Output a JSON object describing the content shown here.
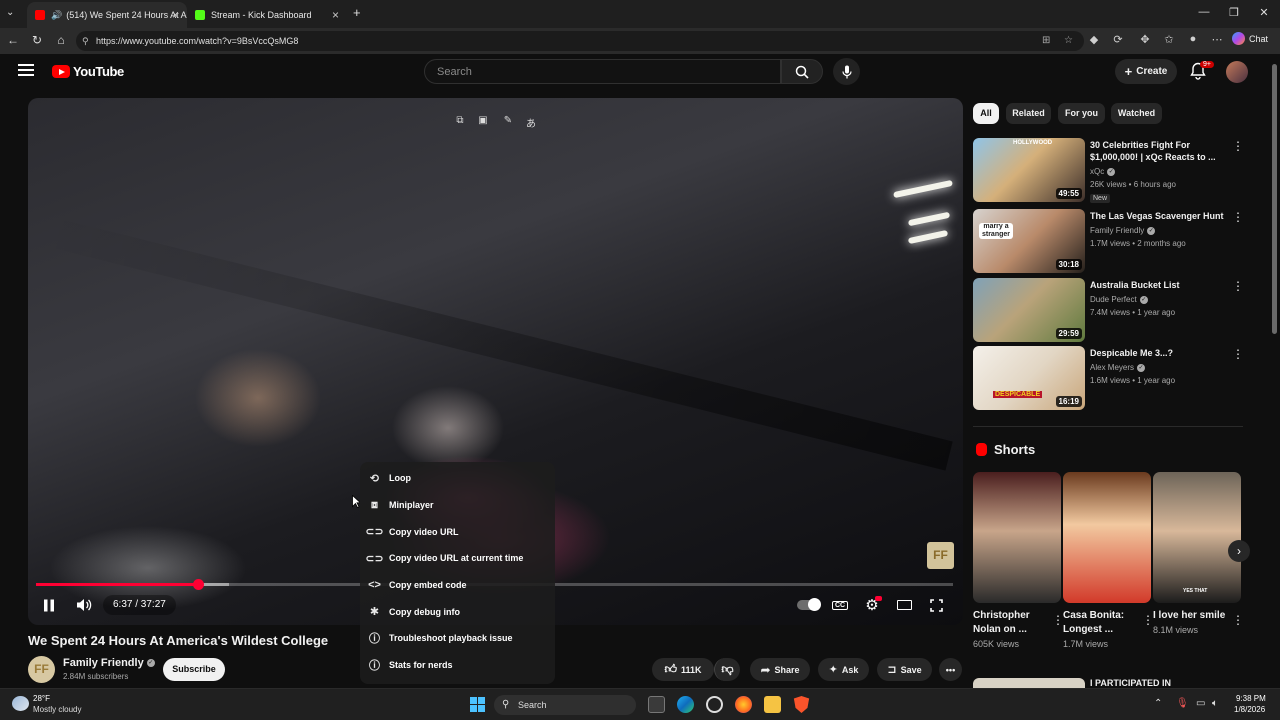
{
  "browser": {
    "tabs": [
      {
        "title": "(514) We Spent 24 Hours At A",
        "active": true
      },
      {
        "title": "Stream - Kick Dashboard",
        "active": false
      }
    ],
    "new_tab": "+",
    "url": "https://www.youtube.com/watch?v=9BsVccQsMG8",
    "chat_label": "Chat"
  },
  "youtube": {
    "logo_text": "YouTube",
    "search_placeholder": "Search",
    "create_label": "Create",
    "notification_count": "9+"
  },
  "player": {
    "current_time": "6:37",
    "duration": "37:27",
    "time_display": "6:37 / 37:27",
    "progress_fraction": 0.177,
    "buffered_fraction": 0.21,
    "watermark": "FF"
  },
  "context_menu": {
    "items": [
      {
        "label": "Loop",
        "icon": "loop-icon"
      },
      {
        "label": "Miniplayer",
        "icon": "miniplayer-icon"
      },
      {
        "label": "Copy video URL",
        "icon": "link-icon"
      },
      {
        "label": "Copy video URL at current time",
        "icon": "link-icon"
      },
      {
        "label": "Copy embed code",
        "icon": "code-icon"
      },
      {
        "label": "Copy debug info",
        "icon": "debug-icon"
      },
      {
        "label": "Troubleshoot playback issue",
        "icon": "help-icon"
      },
      {
        "label": "Stats for nerds",
        "icon": "info-icon"
      }
    ]
  },
  "video": {
    "title": "We Spent 24 Hours At America's Wildest College",
    "channel": "Family Friendly",
    "subscribers": "2.84M subscribers",
    "subscribe_label": "Subscribe",
    "likes": "111K",
    "share_label": "Share",
    "ask_label": "Ask",
    "save_label": "Save"
  },
  "sidebar": {
    "chips": [
      {
        "label": "All",
        "active": true
      },
      {
        "label": "Related",
        "active": false
      },
      {
        "label": "For you",
        "active": false
      },
      {
        "label": "Watched",
        "active": false
      }
    ],
    "recommendations": [
      {
        "title": "30 Celebrities Fight For $1,000,000! | xQc Reacts to ...",
        "channel": "xQc",
        "meta": "26K views • 6 hours ago",
        "duration": "49:55",
        "badge": "New",
        "thumb_overlay": "HOLLYWOOD"
      },
      {
        "title": "The Las Vegas Scavenger Hunt",
        "channel": "Family Friendly",
        "meta": "1.7M views • 2 months ago",
        "duration": "30:18",
        "badge": "",
        "thumb_overlay": "marry a stranger"
      },
      {
        "title": "Australia Bucket List",
        "channel": "Dude Perfect",
        "meta": "7.4M views • 1 year ago",
        "duration": "29:59",
        "badge": "",
        "thumb_overlay": ""
      },
      {
        "title": "Despicable Me 3...?",
        "channel": "Alex Meyers",
        "meta": "1.6M views • 1 year ago",
        "duration": "16:19",
        "badge": "",
        "thumb_overlay": "DESPICABLE"
      }
    ],
    "shorts_heading": "Shorts",
    "shorts": [
      {
        "title": "Christopher Nolan on ...",
        "views": "605K views"
      },
      {
        "title": "Casa Bonita: Longest ...",
        "views": "1.7M views"
      },
      {
        "title": "I love her smile",
        "views": "8.1M views",
        "overlay": "YES THAT"
      }
    ],
    "next_title": "I PARTICIPATED IN"
  },
  "taskbar": {
    "temperature": "28°F",
    "weather": "Mostly cloudy",
    "search_label": "Search",
    "time": "9:38 PM",
    "date": "1/8/2026"
  }
}
